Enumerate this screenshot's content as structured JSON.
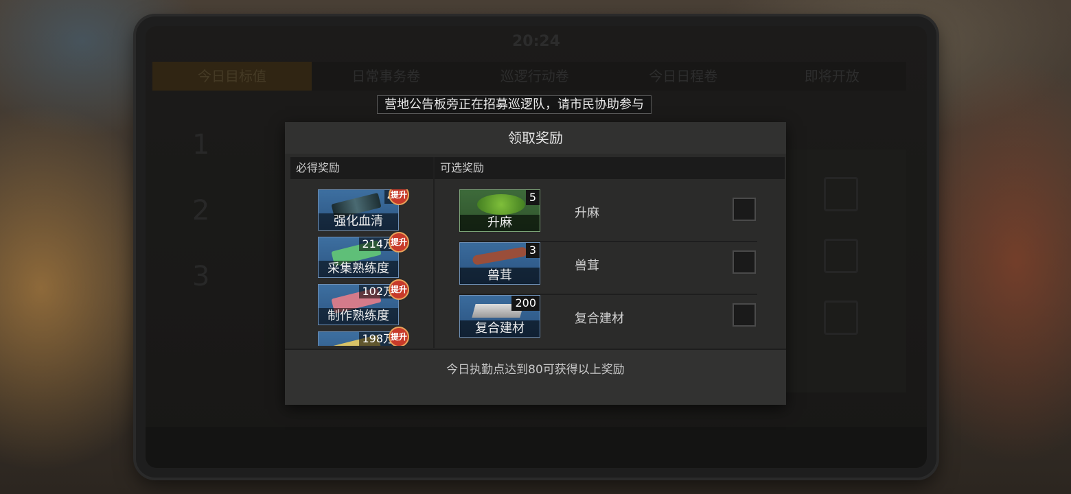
{
  "background": {
    "status_time": "20:24",
    "tabs": [
      "今日目标值",
      "日常事务卷",
      "巡逻行动卷",
      "今日日程卷",
      "即将开放"
    ]
  },
  "notice": "营地公告板旁正在招募巡逻队，请市民协助参与",
  "modal": {
    "title": "领取奖励",
    "required_title": "必得奖励",
    "optional_title": "可选奖励",
    "footer_text": "今日执勤点达到80可获得以上奖励"
  },
  "required_rewards": [
    {
      "name": "强化血清",
      "count": "4",
      "badge": "提升"
    },
    {
      "name": "采集熟练度",
      "count": "214万",
      "badge": "提升"
    },
    {
      "name": "制作熟练度",
      "count": "102万",
      "badge": "提升"
    },
    {
      "name": "",
      "count": "198万",
      "badge": "提升"
    }
  ],
  "optional_rewards": [
    {
      "name": "升麻",
      "count": "5",
      "label": "升麻",
      "checked": false
    },
    {
      "name": "兽茸",
      "count": "3",
      "label": "兽茸",
      "checked": false
    },
    {
      "name": "复合建材",
      "count": "200",
      "label": "复合建材",
      "checked": false
    }
  ],
  "colors": {
    "badge": "#c73a2a",
    "item_blue": "#3d6fa0",
    "item_green": "#3d6a3a"
  }
}
